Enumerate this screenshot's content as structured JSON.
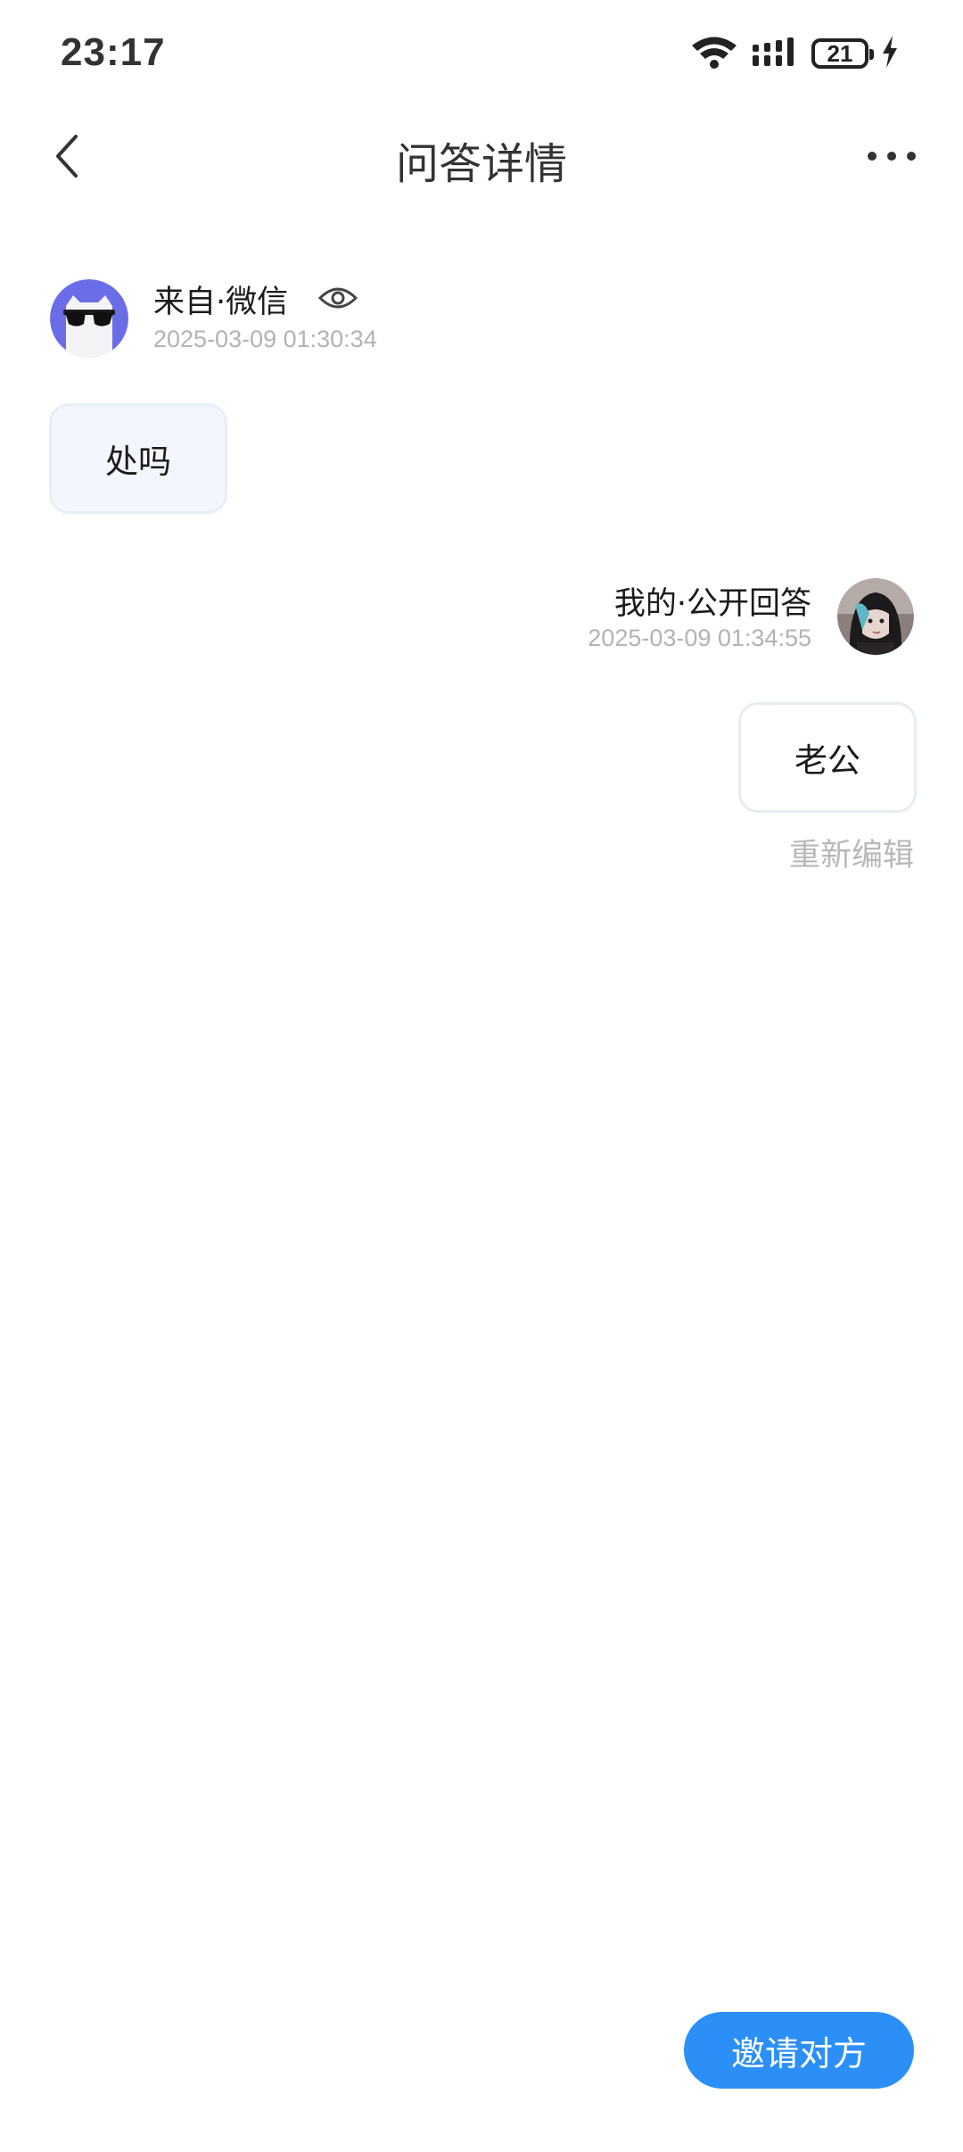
{
  "status_bar": {
    "time": "23:17",
    "battery_level": "21",
    "icons": [
      "wifi-icon",
      "signal-icon",
      "battery-icon",
      "charging-icon"
    ]
  },
  "nav": {
    "title": "问答详情",
    "icons": [
      "back-chevron-icon",
      "more-dots-icon"
    ]
  },
  "question": {
    "source": "来自·微信",
    "time": "2025-03-09 01:30:34",
    "text": "处吗",
    "avatar": "cat-sunglasses-avatar",
    "visibility_icon": "eye-icon"
  },
  "answer": {
    "title": "我的·公开回答",
    "time": "2025-03-09 01:34:55",
    "text": "老公",
    "re_edit_label": "重新编辑",
    "avatar": "user-photo-avatar"
  },
  "footer": {
    "invite_label": "邀请对方"
  },
  "colors": {
    "accent": "#2b8ff7",
    "muted_text": "#b3b3b3",
    "question_bubble": "#f3f7fd",
    "avatar_purple": "#6a6ce8"
  }
}
